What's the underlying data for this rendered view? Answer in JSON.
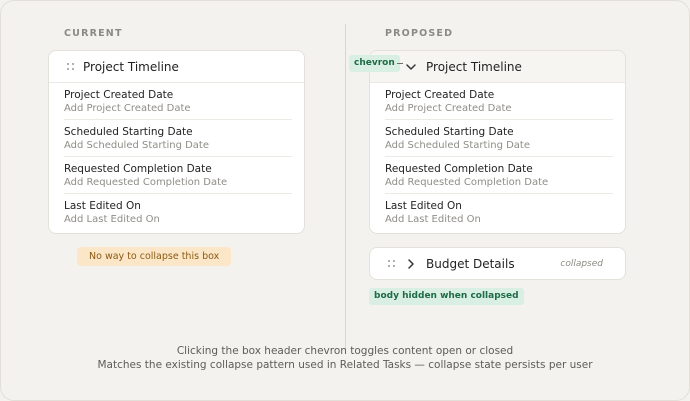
{
  "columns": {
    "current": "CURRENT",
    "proposed": "PROPOSED"
  },
  "current_card": {
    "title": "Project Timeline",
    "rows": [
      {
        "label": "Project Created Date",
        "value": "Add Project Created Date"
      },
      {
        "label": "Scheduled Starting Date",
        "value": "Add Scheduled Starting Date"
      },
      {
        "label": "Requested Completion Date",
        "value": "Add Requested Completion Date"
      },
      {
        "label": "Last Edited On",
        "value": "Add Last Edited On"
      }
    ]
  },
  "current_note": "No way to collapse this box",
  "proposed_card": {
    "title": "Project Timeline",
    "chevron_tag": "chevron",
    "rows": [
      {
        "label": "Project Created Date",
        "value": "Add Project Created Date"
      },
      {
        "label": "Scheduled Starting Date",
        "value": "Add Scheduled Starting Date"
      },
      {
        "label": "Requested Completion Date",
        "value": "Add Requested Completion Date"
      },
      {
        "label": "Last Edited On",
        "value": "Add Last Edited On"
      }
    ]
  },
  "budget_card": {
    "title": "Budget Details",
    "state": "collapsed"
  },
  "budget_note": "body hidden when collapsed",
  "footer": {
    "line1": "Clicking the box header chevron toggles content open or closed",
    "line2": "Matches the existing collapse pattern used in Related Tasks — collapse state persists per user"
  },
  "colors": {
    "warn_bg": "#fbe7c8",
    "tag_bg": "#d9efe3",
    "tag_text": "#1e6b45"
  },
  "icons": [
    "drag-handle-icon",
    "chevron-down-icon",
    "chevron-right-icon"
  ]
}
